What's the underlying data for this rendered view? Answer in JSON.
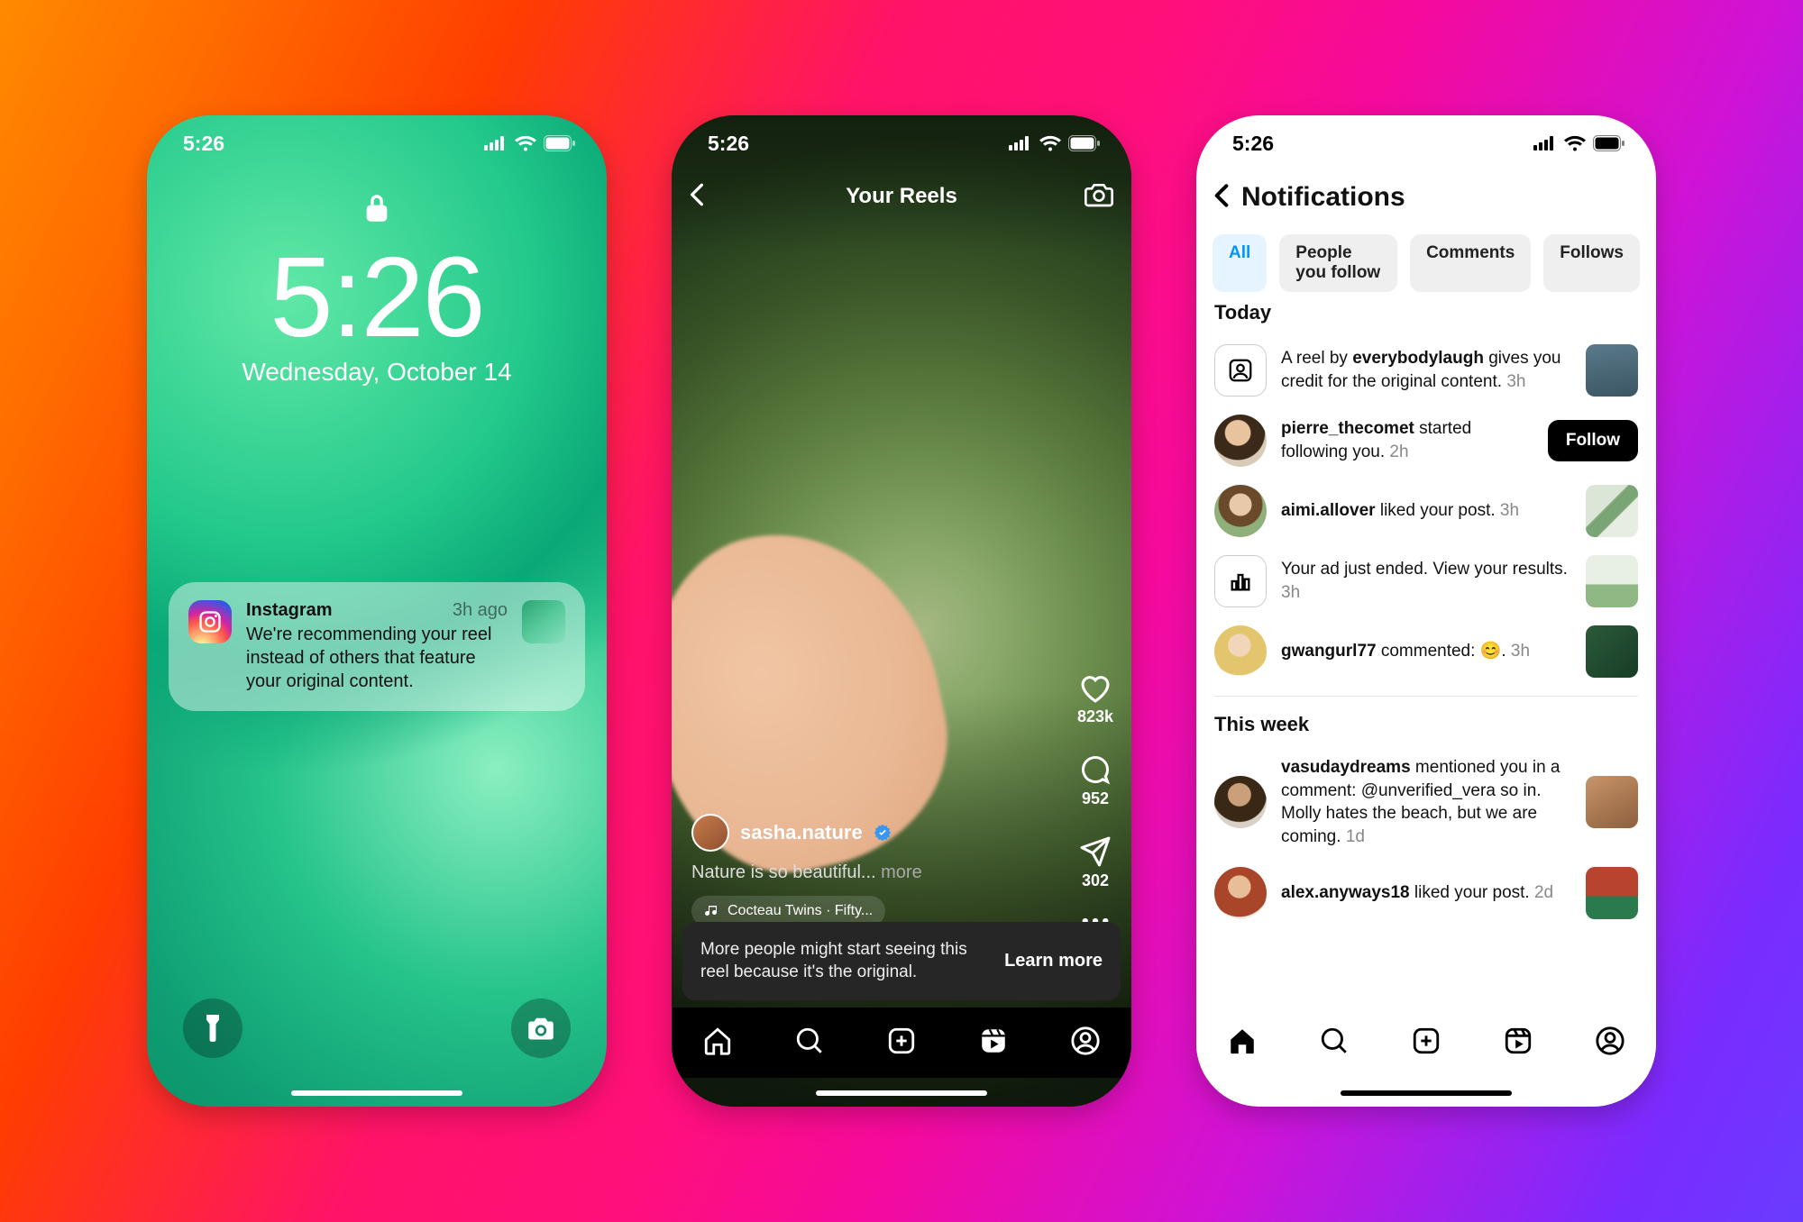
{
  "status": {
    "time": "5:26"
  },
  "phone1": {
    "clock": "5:26",
    "date": "Wednesday, October 14",
    "notif": {
      "app": "Instagram",
      "ago": "3h ago",
      "message": "We're recommending your reel instead of others that feature your original content."
    }
  },
  "phone2": {
    "title": "Your Reels",
    "user": "sasha.nature",
    "caption": "Nature is so beautiful...",
    "more": "more",
    "music": "Cocteau Twins · Fifty...",
    "likes": "823k",
    "comments": "952",
    "shares": "302",
    "banner_text": "More people might start seeing this reel because it's the original.",
    "banner_cta": "Learn more"
  },
  "phone3": {
    "title": "Notifications",
    "filters": {
      "all": "All",
      "people": "People you follow",
      "comments": "Comments",
      "follows": "Follows"
    },
    "section_today": "Today",
    "section_week": "This week",
    "follow_btn": "Follow",
    "items": {
      "credit_pre": "A reel by ",
      "credit_user": "everybodylaugh",
      "credit_post": " gives you credit for the original content.",
      "credit_time": "3h",
      "follow_user": "pierre_thecomet",
      "follow_post": " started following you.",
      "follow_time": "2h",
      "like1_user": "aimi.allover",
      "like1_post": " liked your post.",
      "like1_time": "3h",
      "ad_text": "Your ad just ended. View your results.",
      "ad_time": "3h",
      "comment_user": "gwangurl77",
      "comment_post": " commented: ",
      "comment_emoji": "😊",
      "comment_post2": ".",
      "comment_time": "3h",
      "mention_user": "vasudaydreams",
      "mention_post": " mentioned you in a comment: @unverified_vera so in. Molly hates the beach, but we are coming.",
      "mention_time": "1d",
      "like2_user": "alex.anyways18",
      "like2_post": " liked your post.",
      "like2_time": "2d"
    }
  }
}
